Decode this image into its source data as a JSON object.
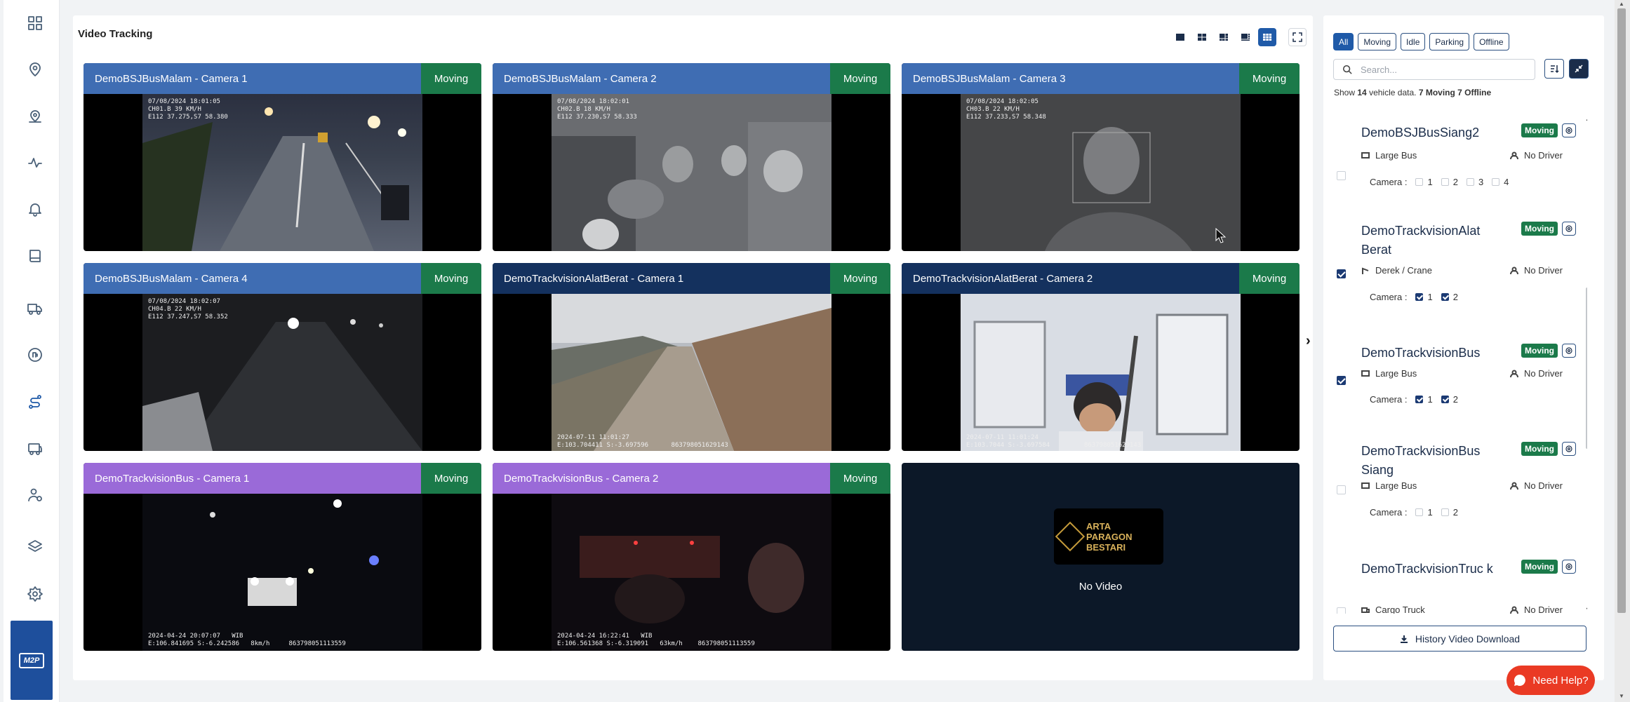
{
  "app": {
    "page_title": "Video Tracking",
    "brand_logo_text": "M2P"
  },
  "sidebar": {
    "icons": [
      "grid-icon",
      "location-pin-icon",
      "location-multi-icon",
      "activity-icon",
      "bell-icon",
      "book-icon",
      "truck-icon",
      "fuel-icon",
      "route-icon",
      "bus-icon",
      "driver-icon",
      "layers-icon",
      "settings-icon"
    ],
    "active_icon": "route-icon"
  },
  "layout_toolbar": {
    "options": [
      "layout-1-icon",
      "layout-4-icon",
      "layout-6-icon",
      "layout-8-icon",
      "layout-9-icon"
    ],
    "active": "layout-9-icon",
    "fullscreen_icon": "fullscreen-icon"
  },
  "cameras": [
    {
      "title": "DemoBSJBusMalam - Camera 1",
      "status": "Moving",
      "header_color": "#3f6db3",
      "osd": "07/08/2024 18:01:05\nCH01.B 39 KM/H\nE112 37.275,S7 58.380",
      "bottom_osd": ""
    },
    {
      "title": "DemoBSJBusMalam - Camera 2",
      "status": "Moving",
      "header_color": "#3f6db3",
      "osd": "07/08/2024 18:02:01\nCH02.B 18 KM/H\nE112 37.230,S7 58.333",
      "bottom_osd": ""
    },
    {
      "title": "DemoBSJBusMalam - Camera 3",
      "status": "Moving",
      "header_color": "#3f6db3",
      "osd": "07/08/2024 18:02:05\nCH03.B 22 KM/H\nE112 37.233,S7 58.348",
      "bottom_osd": ""
    },
    {
      "title": "DemoBSJBusMalam - Camera 4",
      "status": "Moving",
      "header_color": "#3f6db3",
      "osd": "07/08/2024 18:02:07\nCH04.B 22 KM/H\nE112 37.247,S7 58.352",
      "bottom_osd": ""
    },
    {
      "title": "DemoTrackvisionAlatBerat - Camera 1",
      "status": "Moving",
      "header_color": "#14315e",
      "osd": "",
      "bottom_osd": "2024-07-11 11:01:27\nE:103.704411 S:-3.697596      863798051629143"
    },
    {
      "title": "DemoTrackvisionAlatBerat - Camera 2",
      "status": "Moving",
      "header_color": "#14315e",
      "osd": "",
      "bottom_osd": "2024-07-11 11:01:24\nE:103.7044 S:-3.697584         863798051629143"
    },
    {
      "title": "DemoTrackvisionBus - Camera 1",
      "status": "Moving",
      "header_color": "#9a6ad8",
      "osd": "",
      "bottom_osd": "2024-04-24 20:07:07   WIB\nE:106.841695 S:-6.242586   8km/h     863798051113559"
    },
    {
      "title": "DemoTrackvisionBus - Camera 2",
      "status": "Moving",
      "header_color": "#9a6ad8",
      "osd": "",
      "bottom_osd": "2024-04-24 16:22:41   WIB\nE:106.561368 S:-6.319091   63km/h    863798051113559"
    }
  ],
  "no_video_tile": {
    "logo_line1": "ARTA",
    "logo_line2": "PARAGON",
    "logo_line3": "BESTARI",
    "label": "No Video"
  },
  "filters": {
    "options": [
      "All",
      "Moving",
      "Idle",
      "Parking",
      "Offline"
    ],
    "active": "All"
  },
  "search": {
    "placeholder": "Search...",
    "value": ""
  },
  "summary": {
    "prefix": "Show",
    "total": "14",
    "mid": "vehicle data.",
    "moving": "7 Moving",
    "offline": "7 Offline"
  },
  "vehicles": [
    {
      "name": "DemoBSJBusSiang2",
      "status": "Moving",
      "type": "Large Bus",
      "driver": "No Driver",
      "camera_label": "Camera :",
      "cameras": [
        {
          "n": "1",
          "on": false
        },
        {
          "n": "2",
          "on": false
        },
        {
          "n": "3",
          "on": false
        },
        {
          "n": "4",
          "on": false
        }
      ],
      "checked": false
    },
    {
      "name": "DemoTrackvisionAlat Berat",
      "status": "Moving",
      "type": "Derek / Crane",
      "driver": "No Driver",
      "camera_label": "Camera :",
      "cameras": [
        {
          "n": "1",
          "on": true
        },
        {
          "n": "2",
          "on": true
        }
      ],
      "checked": true
    },
    {
      "name": "DemoTrackvisionBus",
      "status": "Moving",
      "type": "Large Bus",
      "driver": "No Driver",
      "camera_label": "Camera :",
      "cameras": [
        {
          "n": "1",
          "on": true
        },
        {
          "n": "2",
          "on": true
        }
      ],
      "checked": true
    },
    {
      "name": "DemoTrackvisionBus Siang",
      "status": "Moving",
      "type": "Large Bus",
      "driver": "No Driver",
      "camera_label": "Camera :",
      "cameras": [
        {
          "n": "1",
          "on": false
        },
        {
          "n": "2",
          "on": false
        }
      ],
      "checked": false
    },
    {
      "name": "DemoTrackvisionTruc k",
      "status": "Moving",
      "type": "Cargo Truck",
      "driver": "No Driver",
      "camera_label": "",
      "cameras": [],
      "checked": false
    }
  ],
  "history_button": "History Video Download",
  "help_button": "Need Help?",
  "colors": {
    "moving_green": "#1b7a4a",
    "primary_blue": "#1f5aa8",
    "help_red": "#ea3a24"
  }
}
